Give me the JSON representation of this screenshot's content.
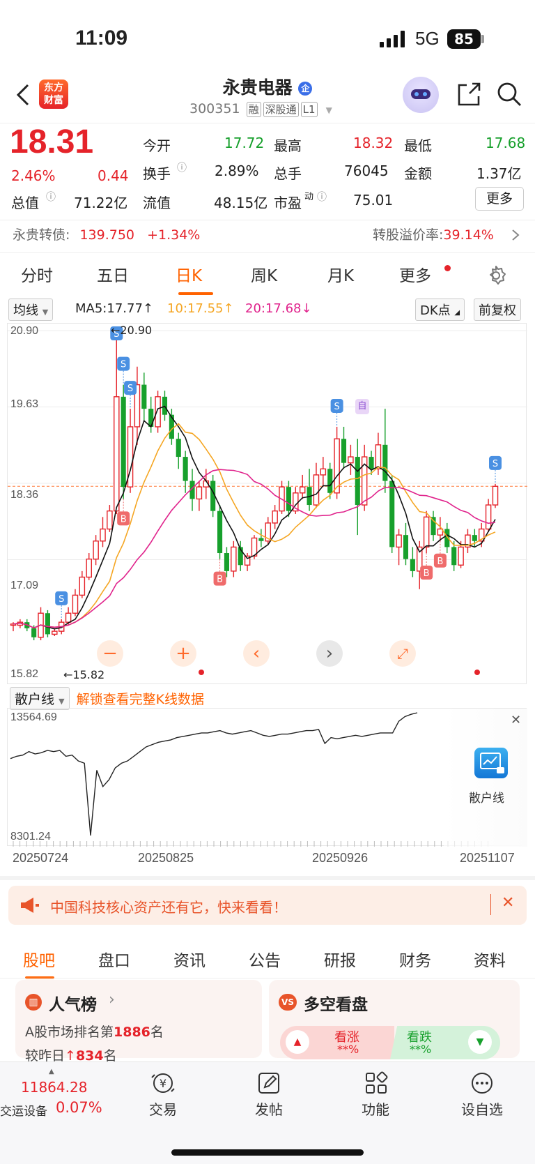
{
  "status_bar": {
    "time": "11:09",
    "network": "5G",
    "battery": "85"
  },
  "header": {
    "logo_text": "东方财富",
    "stock_name": "永贵电器",
    "company_badge": "企",
    "code": "300351",
    "tags": [
      "融",
      "深股通",
      "L1"
    ]
  },
  "quote": {
    "price": "18.31",
    "change_pct": "2.46%",
    "change": "0.44",
    "rows": [
      [
        {
          "label": "今开",
          "value": "17.72",
          "color": "green"
        },
        {
          "label": "最高",
          "value": "18.32",
          "color": "red"
        },
        {
          "label": "最低",
          "value": "17.68",
          "color": "green"
        }
      ],
      [
        {
          "label": "换手",
          "value": "2.89%",
          "color": "black"
        },
        {
          "label": "总手",
          "value": "76045",
          "color": "black"
        },
        {
          "label": "金额",
          "value": "1.37亿",
          "color": "black"
        }
      ]
    ],
    "mktcap_label": "总值",
    "mktcap_value": "71.22亿",
    "float_label": "流值",
    "float_value": "48.15亿",
    "pe_label": "市盈",
    "pe_sup": "动",
    "pe_value": "75.01",
    "more_button": "更多"
  },
  "bond": {
    "label": "永贵转债:",
    "price": "139.750",
    "change": "+1.34%",
    "premium_label": "转股溢价率:",
    "premium_value": "39.14%"
  },
  "tabs": [
    "分时",
    "五日",
    "日K",
    "周K",
    "月K",
    "更多"
  ],
  "active_tab": "日K",
  "chart_toolbar": {
    "indicator": "均线",
    "ma5": "MA5:17.77",
    "ma10": "10:17.55",
    "ma20": "20:17.68",
    "dk_button": "DK点",
    "adjust_button": "前复权"
  },
  "chart_data": [
    {
      "type": "candlestick",
      "y_ticks": [
        "20.90",
        "19.63",
        "18.36",
        "17.09",
        "15.82"
      ],
      "ylim": [
        15.82,
        20.9
      ],
      "high_label": "20.90",
      "low_label": "15.82",
      "series": [
        {
          "name": "K",
          "ohlc": [
            [
              16.0,
              16.05,
              15.9,
              16.02
            ],
            [
              16.0,
              16.1,
              15.95,
              16.05
            ],
            [
              16.05,
              16.1,
              15.9,
              15.95
            ],
            [
              15.95,
              16.0,
              15.75,
              15.8
            ],
            [
              15.8,
              16.3,
              15.75,
              16.2
            ],
            [
              16.2,
              16.25,
              15.8,
              15.85
            ],
            [
              15.85,
              15.95,
              15.82,
              15.9
            ],
            [
              15.9,
              16.1,
              15.85,
              16.05
            ],
            [
              16.05,
              16.3,
              16.0,
              16.2
            ],
            [
              16.2,
              16.6,
              16.15,
              16.5
            ],
            [
              16.5,
              16.9,
              16.45,
              16.8
            ],
            [
              16.8,
              17.2,
              16.75,
              17.1
            ],
            [
              17.1,
              17.5,
              17.0,
              17.4
            ],
            [
              17.4,
              17.8,
              17.3,
              17.6
            ],
            [
              17.6,
              18.0,
              17.55,
              17.9
            ],
            [
              17.9,
              20.9,
              17.85,
              19.8
            ],
            [
              19.8,
              20.0,
              18.1,
              18.3
            ],
            [
              18.3,
              19.6,
              18.2,
              19.3
            ],
            [
              19.3,
              20.3,
              19.0,
              20.0
            ],
            [
              20.0,
              20.2,
              19.4,
              19.6
            ],
            [
              19.6,
              19.8,
              19.2,
              19.3
            ],
            [
              19.3,
              19.9,
              19.2,
              19.8
            ],
            [
              19.8,
              19.9,
              19.4,
              19.5
            ],
            [
              19.5,
              19.6,
              19.0,
              19.1
            ],
            [
              19.1,
              19.2,
              18.6,
              18.8
            ],
            [
              18.8,
              18.9,
              18.2,
              18.4
            ],
            [
              18.4,
              18.6,
              17.9,
              18.1
            ],
            [
              18.1,
              18.4,
              17.9,
              18.3
            ],
            [
              18.3,
              18.6,
              18.1,
              18.4
            ],
            [
              18.4,
              18.5,
              17.8,
              17.9
            ],
            [
              17.9,
              18.0,
              17.1,
              17.2
            ],
            [
              17.2,
              17.3,
              16.8,
              16.9
            ],
            [
              16.9,
              17.4,
              16.8,
              17.3
            ],
            [
              17.3,
              17.4,
              16.9,
              17.0
            ],
            [
              17.0,
              17.2,
              16.9,
              17.15
            ],
            [
              17.15,
              17.5,
              17.1,
              17.45
            ],
            [
              17.45,
              17.6,
              17.3,
              17.4
            ],
            [
              17.4,
              17.8,
              17.35,
              17.7
            ],
            [
              17.7,
              18.0,
              17.6,
              17.9
            ],
            [
              17.9,
              18.4,
              17.85,
              18.3
            ],
            [
              18.3,
              18.4,
              17.8,
              17.9
            ],
            [
              17.9,
              18.3,
              17.85,
              18.2
            ],
            [
              18.2,
              18.5,
              18.1,
              18.3
            ],
            [
              18.3,
              18.6,
              17.9,
              18.0
            ],
            [
              18.0,
              18.7,
              17.95,
              18.5
            ],
            [
              18.5,
              18.8,
              18.3,
              18.6
            ],
            [
              18.6,
              18.7,
              18.1,
              18.2
            ],
            [
              18.2,
              19.3,
              18.1,
              19.1
            ],
            [
              19.1,
              19.3,
              18.6,
              18.7
            ],
            [
              18.7,
              19.0,
              18.5,
              18.8
            ],
            [
              18.8,
              19.1,
              17.5,
              18.0
            ],
            [
              18.0,
              19.0,
              17.9,
              18.8
            ],
            [
              18.8,
              18.9,
              18.5,
              18.6
            ],
            [
              18.6,
              19.2,
              18.5,
              19.0
            ],
            [
              19.0,
              19.6,
              18.2,
              18.4
            ],
            [
              18.4,
              18.5,
              17.2,
              17.3
            ],
            [
              17.3,
              17.6,
              17.0,
              17.5
            ],
            [
              17.5,
              17.7,
              17.0,
              17.1
            ],
            [
              17.1,
              17.3,
              16.8,
              16.9
            ],
            [
              16.9,
              17.4,
              16.6,
              17.3
            ],
            [
              17.3,
              17.9,
              17.2,
              17.8
            ],
            [
              17.8,
              17.9,
              17.4,
              17.5
            ],
            [
              17.5,
              17.8,
              17.4,
              17.6
            ],
            [
              17.6,
              17.7,
              17.2,
              17.3
            ],
            [
              17.3,
              17.4,
              16.9,
              17.0
            ],
            [
              17.0,
              17.4,
              16.95,
              17.3
            ],
            [
              17.3,
              17.6,
              17.2,
              17.5
            ],
            [
              17.5,
              17.6,
              17.3,
              17.4
            ],
            [
              17.4,
              17.7,
              17.3,
              17.6
            ],
            [
              17.6,
              18.1,
              17.55,
              18.0
            ],
            [
              18.0,
              18.35,
              17.95,
              18.31
            ]
          ]
        },
        {
          "name": "MA5",
          "color": "#111111"
        },
        {
          "name": "10",
          "color": "#f5a623"
        },
        {
          "name": "20",
          "color": "#e0238c"
        }
      ],
      "signals_s": [
        "S",
        "S",
        "S",
        "S",
        "S",
        "S"
      ],
      "signals_b": [
        "B",
        "B",
        "B",
        "B"
      ],
      "self_tag": "自"
    },
    {
      "type": "line",
      "indicator": "散户线",
      "y_ticks": [
        "13564.69",
        "8301.24"
      ],
      "ylim": [
        8301.24,
        13564.69
      ],
      "x_ticks": [
        "20250724",
        "20250825",
        "20250926",
        "20251107"
      ],
      "series": [
        {
          "name": "散户线",
          "values": [
            11600,
            11700,
            11750,
            11900,
            11800,
            11850,
            11950,
            11900,
            11950,
            11700,
            11750,
            11500,
            11400,
            8301,
            11100,
            10400,
            10700,
            11200,
            11400,
            11500,
            11700,
            11900,
            12100,
            12200,
            12300,
            12350,
            12400,
            12500,
            12550,
            12600,
            12650,
            12700,
            12700,
            12750,
            12800,
            12700,
            12650,
            12700,
            12750,
            12800,
            12700,
            12600,
            12550,
            12600,
            12650,
            12650,
            12700,
            12750,
            12800,
            12800,
            12850,
            12250,
            12500,
            12450,
            12500,
            12550,
            12600,
            12550,
            12600,
            12650,
            12700,
            12700,
            12700,
            13200,
            13400,
            13500,
            13564
          ]
        }
      ]
    }
  ],
  "chart_controls": [
    "minus",
    "plus",
    "prev",
    "next",
    "expand"
  ],
  "indicator_bar": {
    "selector": "散户线",
    "unlock_text": "解锁查看完整K线数据"
  },
  "side_card": {
    "label": "散户线"
  },
  "banner": {
    "text": "中国科技核心资产还有它，快来看看！"
  },
  "bottom_tabs": [
    "股吧",
    "盘口",
    "资讯",
    "公告",
    "研报",
    "财务",
    "资料"
  ],
  "popularity": {
    "title": "人气榜",
    "rank_prefix": "A股市场排名第",
    "rank": "1886",
    "rank_suffix": "名",
    "delta_prefix": "较昨日",
    "delta": "834",
    "delta_suffix": "名"
  },
  "long_short": {
    "title": "多空看盘",
    "up_label": "看涨",
    "up_pct": "**%",
    "down_label": "看跌",
    "down_pct": "**%"
  },
  "bottom_bar": {
    "index_name": "交运设备",
    "index_value": "11864.28",
    "index_change": "0.07%",
    "items": [
      "交易",
      "发帖",
      "功能",
      "设自选"
    ]
  },
  "colors": {
    "up": "#e5232a",
    "down": "#17a02c",
    "accent": "#ff6200",
    "ma10": "#f5a623",
    "ma20": "#e0238c"
  }
}
